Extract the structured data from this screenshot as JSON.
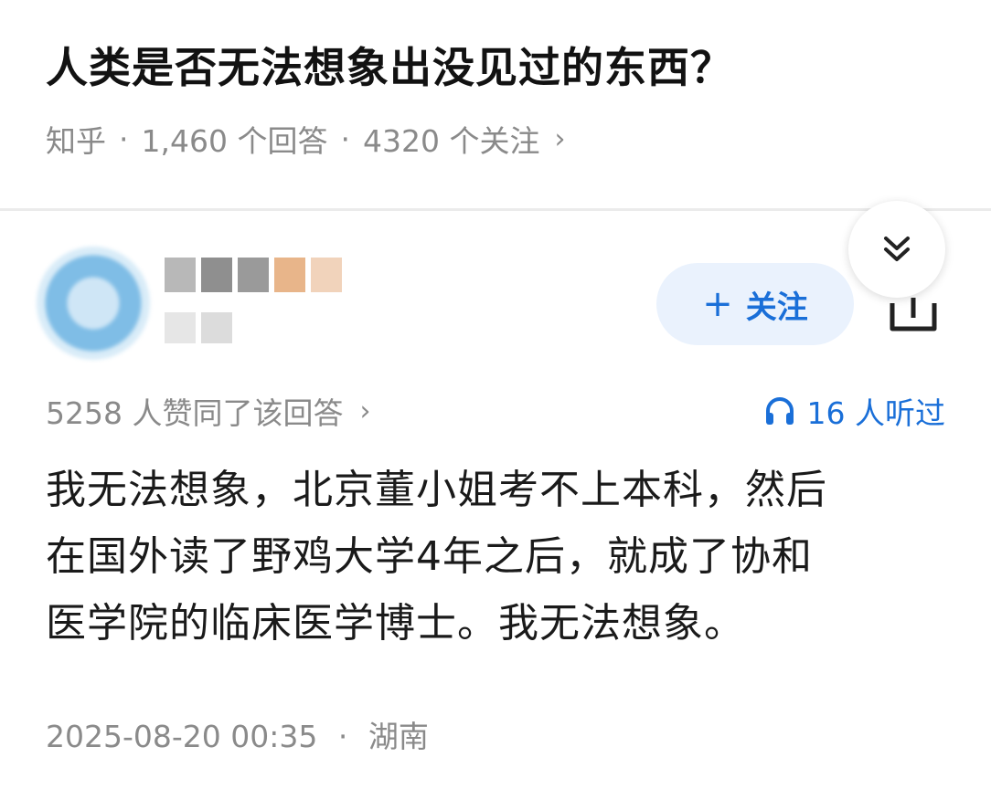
{
  "question": {
    "title": "人类是否无法想象出没见过的东西？",
    "source": "知乎",
    "answer_count": "1,460 个回答",
    "follow_count": "4320 个关注",
    "separator": "·",
    "chevron": "›"
  },
  "author": {
    "follow_label": "关注",
    "follow_plus": "+"
  },
  "answer": {
    "upvote_text": "5258 人赞同了该回答",
    "upvote_chevron": "›",
    "listen_text": "16 人听过",
    "lines": [
      "我无法想象，北京董小姐考不上本科，然后",
      "在国外读了野鸡大学4年之后，就成了协和",
      "医学院的临床医学博士。我无法想象。"
    ],
    "date": "2025-08-20 00:35",
    "separator": "·",
    "location": "湖南"
  },
  "colors": {
    "accent": "#1a6fd8",
    "follow_bg": "#eaf2fd",
    "meta_gray": "#8a8a8a",
    "title": "#121212"
  },
  "icons": {
    "collapse": "double-chevron-down-icon",
    "share": "share-icon",
    "listen": "headphones-icon"
  }
}
